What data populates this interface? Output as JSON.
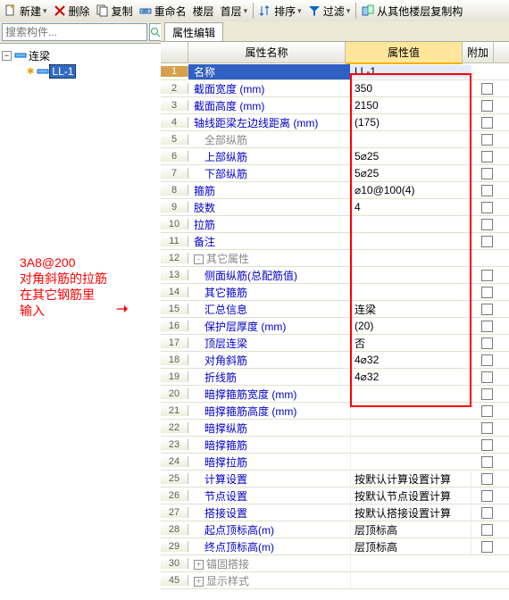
{
  "toolbar": {
    "new": "新建",
    "del": "删除",
    "copy": "复制",
    "rename": "重命名",
    "floor": "楼层",
    "first": "首层",
    "sort": "排序",
    "filter": "过滤",
    "copyfrom": "从其他楼层复制构"
  },
  "search": {
    "placeholder": "搜索构件..."
  },
  "tree": {
    "root": "连梁",
    "child": "LL-1"
  },
  "tab": "属性编辑",
  "head": {
    "name": "属性名称",
    "val": "属性值",
    "att": "附加"
  },
  "rows": [
    {
      "n": "1",
      "name": "名称",
      "val": "LL-1",
      "sel": true
    },
    {
      "n": "2",
      "name": "截面宽度 (mm)",
      "val": "350",
      "blue": true,
      "chk": true
    },
    {
      "n": "3",
      "name": "截面高度 (mm)",
      "val": "2150",
      "blue": true,
      "chk": true
    },
    {
      "n": "4",
      "name": "轴线距梁左边线距离 (mm)",
      "val": "(175)",
      "blue": true,
      "chk": true
    },
    {
      "n": "5",
      "name": "全部纵筋",
      "val": "",
      "gray": true,
      "ind": 1,
      "chk": true
    },
    {
      "n": "6",
      "name": "上部纵筋",
      "val": "5⌀25",
      "blue": true,
      "ind": 1,
      "chk": true
    },
    {
      "n": "7",
      "name": "下部纵筋",
      "val": "5⌀25",
      "blue": true,
      "ind": 1,
      "chk": true
    },
    {
      "n": "8",
      "name": "箍筋",
      "val": "⌀10@100(4)",
      "blue": true,
      "chk": true
    },
    {
      "n": "9",
      "name": "肢数",
      "val": "4",
      "blue": true,
      "chk": true
    },
    {
      "n": "10",
      "name": "拉筋",
      "val": "",
      "blue": true,
      "chk": true
    },
    {
      "n": "11",
      "name": "备注",
      "val": "",
      "blue": true,
      "chk": true
    },
    {
      "n": "12",
      "name": "其它属性",
      "val": "",
      "gray": true,
      "pm": "-"
    },
    {
      "n": "13",
      "name": "侧面纵筋(总配筋值)",
      "val": "",
      "blue": true,
      "ind": 1,
      "chk": true
    },
    {
      "n": "14",
      "name": "其它箍筋",
      "val": "",
      "blue": true,
      "ind": 1,
      "chk": true
    },
    {
      "n": "15",
      "name": "汇总信息",
      "val": "连梁",
      "blue": true,
      "ind": 1,
      "chk": true
    },
    {
      "n": "16",
      "name": "保护层厚度 (mm)",
      "val": "(20)",
      "blue": true,
      "ind": 1,
      "chk": true
    },
    {
      "n": "17",
      "name": "顶层连梁",
      "val": "否",
      "blue": true,
      "ind": 1,
      "chk": true
    },
    {
      "n": "18",
      "name": "对角斜筋",
      "val": "4⌀32",
      "blue": true,
      "ind": 1,
      "chk": true
    },
    {
      "n": "19",
      "name": "折线筋",
      "val": "4⌀32",
      "blue": true,
      "ind": 1,
      "chk": true
    },
    {
      "n": "20",
      "name": "暗撑箍筋宽度 (mm)",
      "val": "",
      "blue": true,
      "ind": 1,
      "chk": true
    },
    {
      "n": "21",
      "name": "暗撑箍筋高度 (mm)",
      "val": "",
      "blue": true,
      "ind": 1,
      "chk": true
    },
    {
      "n": "22",
      "name": "暗撑纵筋",
      "val": "",
      "blue": true,
      "ind": 1,
      "chk": true
    },
    {
      "n": "23",
      "name": "暗撑箍筋",
      "val": "",
      "blue": true,
      "ind": 1,
      "chk": true
    },
    {
      "n": "24",
      "name": "暗撑拉筋",
      "val": "",
      "blue": true,
      "ind": 1,
      "chk": true
    },
    {
      "n": "25",
      "name": "计算设置",
      "val": "按默认计算设置计算",
      "blue": true,
      "ind": 1,
      "chk": true
    },
    {
      "n": "26",
      "name": "节点设置",
      "val": "按默认节点设置计算",
      "blue": true,
      "ind": 1,
      "chk": true
    },
    {
      "n": "27",
      "name": "搭接设置",
      "val": "按默认搭接设置计算",
      "blue": true,
      "ind": 1,
      "chk": true
    },
    {
      "n": "28",
      "name": "起点顶标高(m)",
      "val": "层顶标高",
      "blue": true,
      "ind": 1,
      "chk": true
    },
    {
      "n": "29",
      "name": "终点顶标高(m)",
      "val": "层顶标高",
      "blue": true,
      "ind": 1,
      "chk": true
    },
    {
      "n": "30",
      "name": "锚固搭接",
      "val": "",
      "gray": true,
      "pm": "+"
    },
    {
      "n": "45",
      "name": "显示样式",
      "val": "",
      "gray": true,
      "pm": "+"
    }
  ],
  "annot": {
    "l1": "3A8@200",
    "l2": "对角斜筋的拉筋",
    "l3": "在其它钢筋里",
    "l4": "输入"
  }
}
